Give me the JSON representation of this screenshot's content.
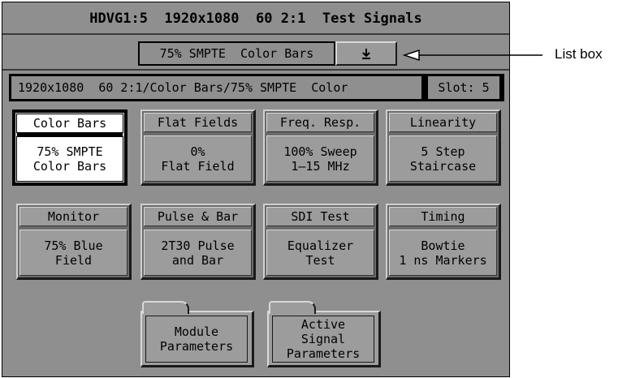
{
  "header": {
    "title": "HDVG1:5  1920x1080  60 2:1  Test Signals"
  },
  "list_box": {
    "selected": "75% SMPTE  Color Bars",
    "dropdown_icon": "down-arrow-icon"
  },
  "status": {
    "path": "1920x1080  60 2:1/Color Bars/75% SMPTE  Color",
    "slot": "Slot: 5"
  },
  "signal_tiles": [
    {
      "category": "Color Bars",
      "value_line1": "75% SMPTE",
      "value_line2": "Color Bars",
      "selected": true
    },
    {
      "category": "Flat Fields",
      "value_line1": "0%",
      "value_line2": "Flat Field",
      "selected": false
    },
    {
      "category": "Freq. Resp.",
      "value_line1": "100% Sweep",
      "value_line2": "1–15 MHz",
      "selected": false
    },
    {
      "category": "Linearity",
      "value_line1": "5 Step",
      "value_line2": "Staircase",
      "selected": false
    },
    {
      "category": "Monitor",
      "value_line1": "75% Blue",
      "value_line2": "Field",
      "selected": false
    },
    {
      "category": "Pulse & Bar",
      "value_line1": "2T30 Pulse",
      "value_line2": "and Bar",
      "selected": false
    },
    {
      "category": "SDI Test",
      "value_line1": "Equalizer",
      "value_line2": "Test",
      "selected": false
    },
    {
      "category": "Timing",
      "value_line1": "Bowtie",
      "value_line2": "1 ns Markers",
      "selected": false
    }
  ],
  "folders": [
    {
      "line1": "Module",
      "line2": "Parameters",
      "line3": ""
    },
    {
      "line1": "Active",
      "line2": "Signal",
      "line3": "Parameters"
    }
  ],
  "annotation": {
    "label": "List box"
  },
  "colors": {
    "screen_bg": "#8f8f8f",
    "selected_bg": "#ffffff",
    "button_face": "#9c9c9c"
  }
}
